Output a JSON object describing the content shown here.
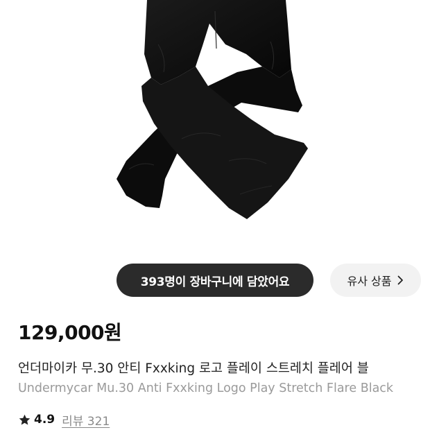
{
  "product": {
    "image_icon": "black-flare-pants-photo",
    "cart_count_text": "393명이 장바구니에 담았어요",
    "similar_label": "유사 상품",
    "similar_icon": "chevron-right-icon",
    "price": "129,000원",
    "name_ko": "언더마이카 무.30 안티 Fxxking 로고 플레이 스트레치 플레어 블",
    "name_en": "Undermycar Mu.30 Anti Fxxking Logo Play Stretch Flare Black",
    "rating_icon": "star-icon",
    "rating": "4.9",
    "review_link": "리뷰 321"
  }
}
